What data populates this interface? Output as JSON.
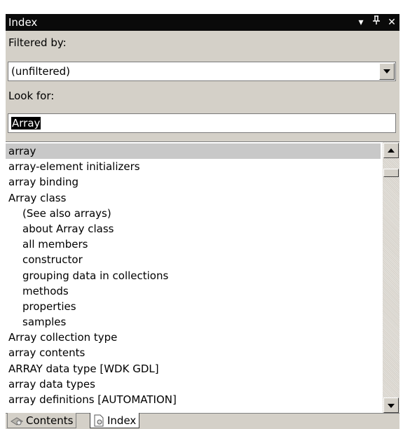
{
  "window": {
    "title": "Index",
    "buttons": {
      "dropdown_glyph": "▾",
      "pin_glyph": "ᵖ",
      "close_glyph": "✕"
    }
  },
  "filter": {
    "label": "Filtered by:",
    "value": "(unfiltered)"
  },
  "look_for": {
    "label": "Look for:",
    "value": "Array"
  },
  "index_list": {
    "items": [
      {
        "text": "array",
        "indent": 0,
        "selected": true
      },
      {
        "text": "array-element initializers",
        "indent": 0
      },
      {
        "text": "array binding",
        "indent": 0
      },
      {
        "text": "Array class",
        "indent": 0
      },
      {
        "text": "(See also arrays)",
        "indent": 1
      },
      {
        "text": "about Array class",
        "indent": 1
      },
      {
        "text": "all members",
        "indent": 1
      },
      {
        "text": "constructor",
        "indent": 1
      },
      {
        "text": "grouping data in collections",
        "indent": 1
      },
      {
        "text": "methods",
        "indent": 1
      },
      {
        "text": "properties",
        "indent": 1
      },
      {
        "text": "samples",
        "indent": 1
      },
      {
        "text": "Array collection type",
        "indent": 0
      },
      {
        "text": "array contents",
        "indent": 0
      },
      {
        "text": "ARRAY data type [WDK GDL]",
        "indent": 0
      },
      {
        "text": "array data types",
        "indent": 0
      },
      {
        "text": "array definitions [AUTOMATION]",
        "indent": 0
      }
    ]
  },
  "tabs": [
    {
      "label": "Contents",
      "icon": "contents-book-icon",
      "active": false
    },
    {
      "label": "Index",
      "icon": "index-page-icon",
      "active": true
    }
  ],
  "colors": {
    "titlebar": "#0a0a0a",
    "panel": "#d4d0c8",
    "selection": "#c8c8c8"
  }
}
